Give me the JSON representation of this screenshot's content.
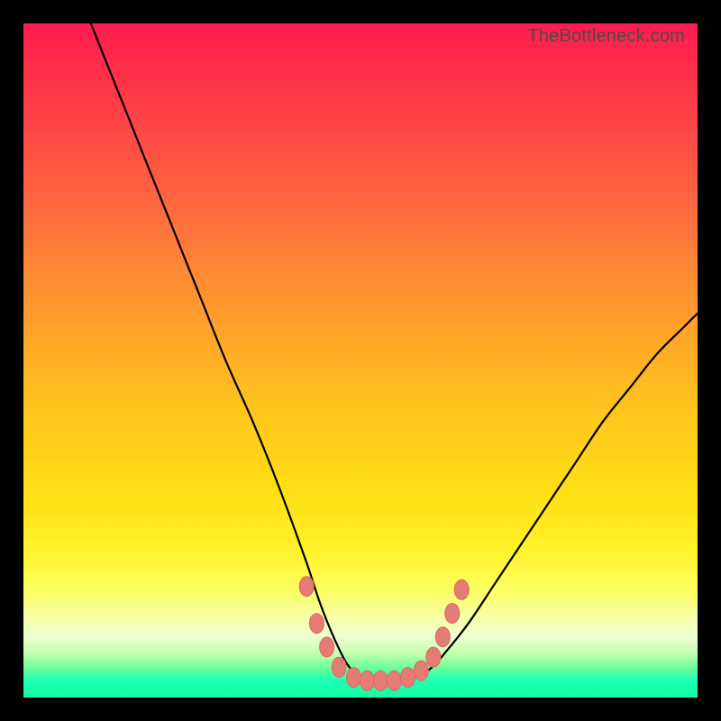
{
  "watermark": "TheBottleneck.com",
  "colors": {
    "curve": "#000000",
    "markers_fill": "#e57b73",
    "markers_stroke": "#d86a62",
    "frame": "#000000"
  },
  "chart_data": {
    "type": "line",
    "title": "",
    "xlabel": "",
    "ylabel": "",
    "xlim": [
      0,
      100
    ],
    "ylim": [
      0,
      100
    ],
    "series": [
      {
        "name": "bottleneck-curve",
        "x": [
          10,
          14,
          18,
          22,
          26,
          30,
          34,
          38,
          42,
          44,
          46,
          48,
          50,
          52,
          54,
          56,
          58,
          60,
          62,
          66,
          70,
          74,
          78,
          82,
          86,
          90,
          94,
          98,
          100
        ],
        "y": [
          100,
          90,
          80,
          70,
          60,
          50,
          41,
          31,
          20,
          14,
          9,
          5,
          3,
          2.5,
          2.5,
          2.5,
          3,
          4,
          6,
          11,
          17,
          23,
          29,
          35,
          41,
          46,
          51,
          55,
          57
        ]
      }
    ],
    "markers": [
      {
        "x": 42.0,
        "y": 16.5
      },
      {
        "x": 43.5,
        "y": 11.0
      },
      {
        "x": 45.0,
        "y": 7.5
      },
      {
        "x": 46.8,
        "y": 4.5
      },
      {
        "x": 49.0,
        "y": 3.0
      },
      {
        "x": 51.0,
        "y": 2.5
      },
      {
        "x": 53.0,
        "y": 2.5
      },
      {
        "x": 55.0,
        "y": 2.5
      },
      {
        "x": 57.0,
        "y": 3.0
      },
      {
        "x": 59.0,
        "y": 4.0
      },
      {
        "x": 60.8,
        "y": 6.0
      },
      {
        "x": 62.2,
        "y": 9.0
      },
      {
        "x": 63.6,
        "y": 12.5
      },
      {
        "x": 65.0,
        "y": 16.0
      }
    ],
    "annotations": []
  }
}
